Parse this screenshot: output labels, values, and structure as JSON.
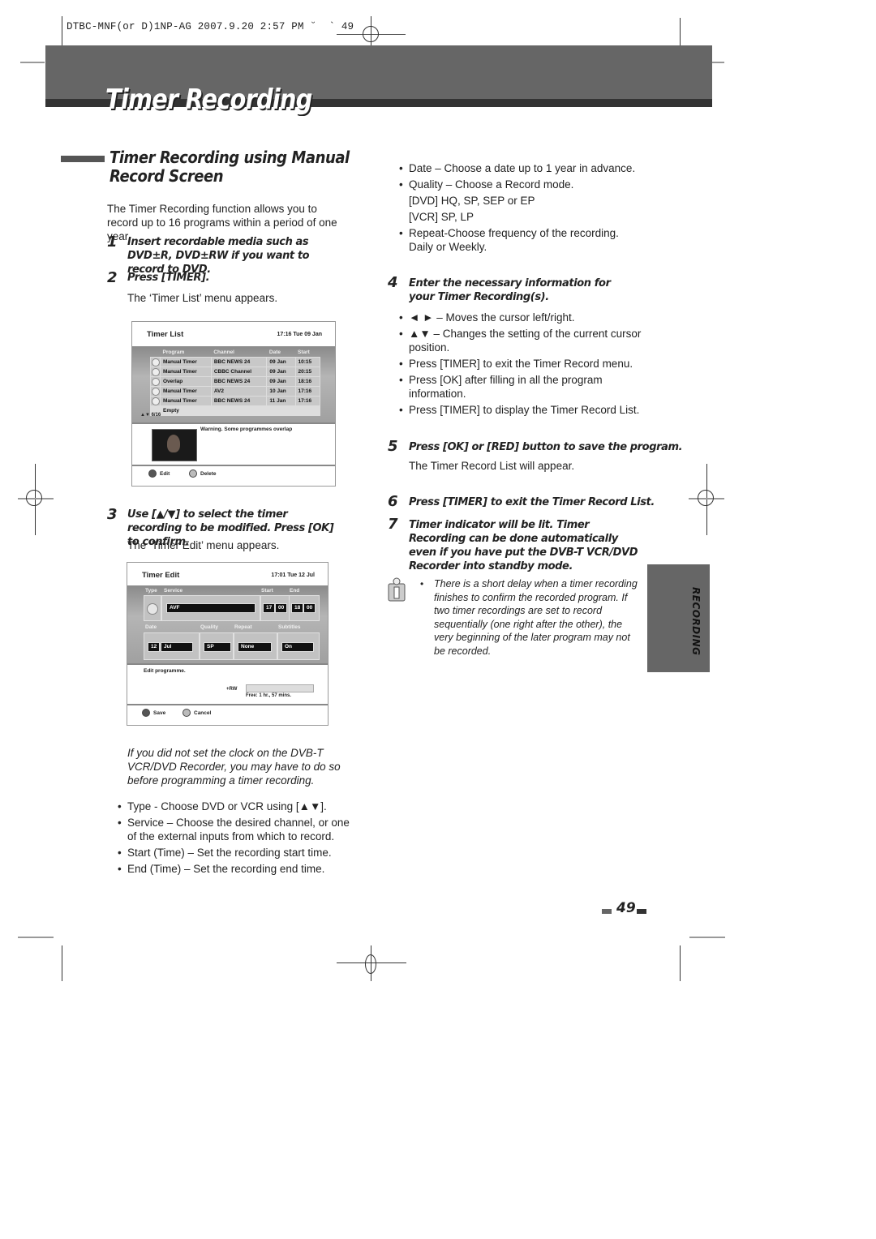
{
  "print_slug": "DTBC-MNF(or D)1NP-AG 2007.9.20 2:57 PM ˘  ` 49",
  "banner_title": "Timer Recording",
  "section_title": "Timer Recording using Manual Record Screen",
  "intro": "The Timer Recording function allows you to record up to 16 programs within a period of one year.",
  "steps": {
    "s1": {
      "num": "1",
      "text": "Insert recordable media such as DVD±R, DVD±RW if you want to record to DVD."
    },
    "s2": {
      "num": "2",
      "text": "Press [TIMER].",
      "note": "The ‘Timer List’ menu appears."
    },
    "s3": {
      "num": "3",
      "text": "Use [▲/▼] to select the timer recording to be modified. Press [OK] to confirm.",
      "note": "The ‘Timer Edit’ menu appears."
    },
    "s4": {
      "num": "4",
      "text": "Enter the necessary information for your Timer Recording(s)."
    },
    "s5": {
      "num": "5",
      "text": "Press [OK] or [RED] button to save the program.",
      "note": "The Timer Record List will appear."
    },
    "s6": {
      "num": "6",
      "text": "Press [TIMER] to exit the Timer Record List."
    },
    "s7": {
      "num": "7",
      "text": "Timer indicator will be lit. Timer Recording can be done automatically even if you have put the DVB-T VCR/DVD Recorder into standby mode."
    }
  },
  "timer_list_screen": {
    "title": "Timer List",
    "clock": "17:16 Tue 09 Jan",
    "columns": [
      "Program",
      "Channel",
      "Date",
      "Start"
    ],
    "rows": [
      {
        "program": "Manual Timer",
        "channel": "BBC NEWS 24",
        "date": "09 Jan",
        "start": "10:15"
      },
      {
        "program": "Manual Timer",
        "channel": "CBBC Channel",
        "date": "09 Jan",
        "start": "20:15"
      },
      {
        "program": "Overlap",
        "channel": "BBC NEWS 24",
        "date": "09 Jan",
        "start": "18:16"
      },
      {
        "program": "Manual Timer",
        "channel": "AV2",
        "date": "10 Jan",
        "start": "17:16"
      },
      {
        "program": "Manual Timer",
        "channel": "BBC NEWS 24",
        "date": "11 Jan",
        "start": "17:16"
      },
      {
        "program": "Empty",
        "channel": "",
        "date": "",
        "start": ""
      }
    ],
    "page_indicator": "6/16",
    "warning": "Warning. Some programmes overlap",
    "buttons": {
      "edit": "Edit",
      "delete": "Delete"
    }
  },
  "timer_edit_screen": {
    "title": "Timer Edit",
    "clock": "17:01 Tue 12 Jul",
    "labels": {
      "type": "Type",
      "service": "Service",
      "start": "Start",
      "end": "End",
      "date": "Date",
      "quality": "Quality",
      "repeat": "Repeat",
      "subtitles": "Subtitles"
    },
    "values": {
      "service": "AVF",
      "start_h": "17",
      "start_m": "00",
      "end_h": "18",
      "end_m": "00",
      "day": "12",
      "month": "Jul",
      "quality": "SP",
      "repeat": "None",
      "subtitles": "On"
    },
    "status": "Edit programme.",
    "media": "+RW",
    "free": "Free: 1 hr., 57 mins.",
    "buttons": {
      "save": "Save",
      "cancel": "Cancel"
    }
  },
  "clock_note": "If you did not set the clock on the DVB-T VCR/DVD Recorder, you may have to do so before programming a timer recording.",
  "left_bullets": [
    "Type - Choose DVD or VCR using [▲▼].",
    "Service – Choose the desired channel, or one of the external inputs from which to record.",
    "Start (Time) – Set the recording start time.",
    "End (Time) – Set the recording end time."
  ],
  "right_bullets_top": [
    "Date – Choose a date up to 1 year in advance.",
    "Quality – Choose a Record mode.",
    "Repeat-Choose frequency of the recording. Daily or Weekly."
  ],
  "quality_modes": {
    "dvd": "[DVD] HQ, SP, SEP or EP",
    "vcr": "[VCR] SP, LP"
  },
  "step4_bullets": [
    "◄ ► – Moves the cursor left/right.",
    "▲▼ – Changes the setting of the current cursor position.",
    "Press [TIMER] to exit the Timer Record menu.",
    "Press [OK] after filling in all the program information.",
    "Press [TIMER] to display the Timer Record List."
  ],
  "info_note": "There is a short delay when a timer recording finishes to confirm the recorded program. If two timer recordings are set to record sequentially (one right after the other), the very beginning of the later program may not be recorded.",
  "side_tab": "RECORDING",
  "page_number": "49",
  "bullet_glyph": "•"
}
